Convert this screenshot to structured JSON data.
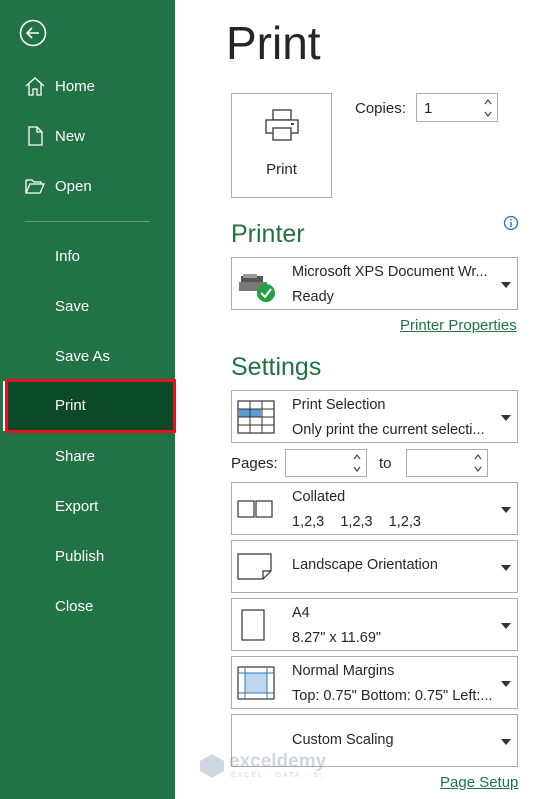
{
  "sidebar": {
    "items": [
      {
        "label": "Home"
      },
      {
        "label": "New"
      },
      {
        "label": "Open"
      },
      {
        "label": "Info"
      },
      {
        "label": "Save"
      },
      {
        "label": "Save As"
      },
      {
        "label": "Print"
      },
      {
        "label": "Share"
      },
      {
        "label": "Export"
      },
      {
        "label": "Publish"
      },
      {
        "label": "Close"
      }
    ],
    "active": "Print"
  },
  "main": {
    "title": "Print",
    "print_button_label": "Print",
    "copies_label": "Copies:",
    "copies_value": "1",
    "printer_heading": "Printer",
    "printer": {
      "name": "Microsoft XPS Document Wr...",
      "status": "Ready"
    },
    "printer_properties_link": "Printer Properties",
    "settings_heading": "Settings",
    "print_what": {
      "title": "Print Selection",
      "subtitle": "Only print the current selecti..."
    },
    "pages_label": "Pages:",
    "pages_to_label": "to",
    "pages_from": "",
    "pages_to": "",
    "collation": {
      "title": "Collated",
      "subtitle": "1,2,3    1,2,3    1,2,3"
    },
    "orientation": {
      "title": "Landscape Orientation"
    },
    "paper": {
      "title": "A4",
      "subtitle": "8.27\" x 11.69\""
    },
    "margins": {
      "title": "Normal Margins",
      "subtitle": "Top: 0.75\" Bottom: 0.75\" Left:..."
    },
    "scaling": {
      "title": "Custom Scaling"
    },
    "page_setup_link": "Page Setup"
  },
  "watermark": {
    "name": "exceldemy",
    "tagline": "EXCEL · DATA · BI"
  },
  "colors": {
    "accent": "#217346",
    "active": "#0b4a28",
    "highlight": "#e81123"
  }
}
